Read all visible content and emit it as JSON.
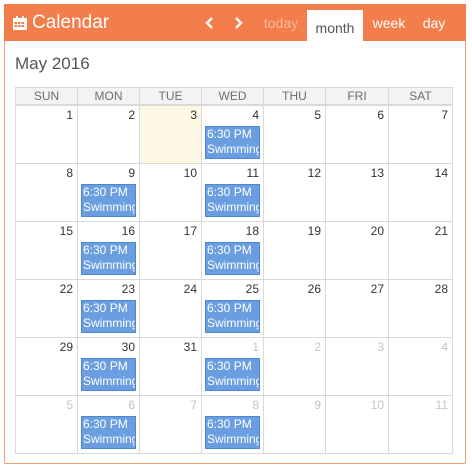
{
  "header": {
    "title": "Calendar",
    "today_label": "today",
    "month_label": "month",
    "week_label": "week",
    "day_label": "day"
  },
  "month_title": "May 2016",
  "weekdays": [
    "SUN",
    "MON",
    "TUE",
    "WED",
    "THU",
    "FRI",
    "SAT"
  ],
  "weeks": [
    [
      "1",
      "2",
      "3",
      "4",
      "5",
      "6",
      "7"
    ],
    [
      "8",
      "9",
      "10",
      "11",
      "12",
      "13",
      "14"
    ],
    [
      "15",
      "16",
      "17",
      "18",
      "19",
      "20",
      "21"
    ],
    [
      "22",
      "23",
      "24",
      "25",
      "26",
      "27",
      "28"
    ],
    [
      "29",
      "30",
      "31",
      "1",
      "2",
      "3",
      "4"
    ],
    [
      "5",
      "6",
      "7",
      "8",
      "9",
      "10",
      "11"
    ]
  ],
  "event": {
    "time": "6:30 PM",
    "title": "Swimming"
  },
  "colors": {
    "header": "#f47d4c",
    "event": "#6a9ee0",
    "today": "#fcf8e3"
  }
}
